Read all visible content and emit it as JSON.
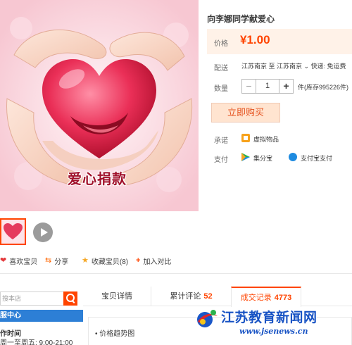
{
  "product": {
    "title": "向李娜同学献爱心",
    "image_caption": "爱心捐款"
  },
  "price": {
    "label": "价格",
    "value": "¥1.00"
  },
  "shipping": {
    "label": "配送",
    "text": "江苏南京  至  江苏南京 ⌄  快递: 免运费"
  },
  "quantity": {
    "label": "数量",
    "minus": "−",
    "value": "1",
    "plus": "+",
    "stock": "件(库存995226件)"
  },
  "buy_button": "立即购买",
  "promise": {
    "label": "承诺",
    "text": "虚拟物品"
  },
  "payment": {
    "label": "支付",
    "options": [
      "集分宝",
      "支付宝支付"
    ]
  },
  "actions": {
    "like": "喜欢宝贝",
    "share": "分享",
    "favorite": "收藏宝贝(8)",
    "compare": "加入对比"
  },
  "search": {
    "placeholder": "搜本店"
  },
  "service": {
    "header": "服中心",
    "work_time_title": "作时间",
    "work_hours": "周一至周五:  9:00-21:00"
  },
  "tabs": [
    {
      "label": "宝贝详情",
      "count": ""
    },
    {
      "label": "累计评论",
      "count": "52"
    },
    {
      "label": "成交记录",
      "count": "4773"
    }
  ],
  "price_trend_label": "价格趋势图",
  "watermark": {
    "name": "江苏教育新闻网",
    "url": "www.jsenews.cn"
  },
  "colors": {
    "accent": "#ff4400",
    "price_bg": "#fff2e8",
    "buy_bg": "#ffe4d0",
    "service_blue": "#2d7fd6",
    "watermark_blue": "#1853c4"
  }
}
